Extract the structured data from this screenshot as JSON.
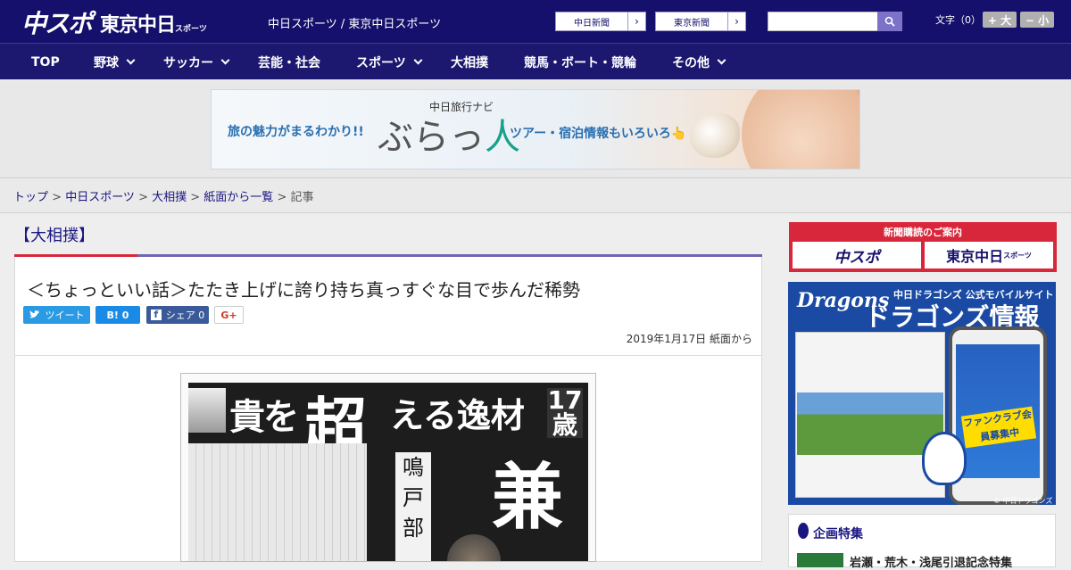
{
  "header": {
    "logo_chunichi_sports": "中スポ",
    "logo_tokyo_chunichi": "東京中日",
    "logo_tokyo_chunichi_sub": "スポーツ",
    "site_name": "中日スポーツ / 東京中日スポーツ",
    "link_chunichi_shimbun": "中日新聞",
    "link_tokyo_shimbun": "東京新聞",
    "search_placeholder": "",
    "font_size_label": "文字（0）",
    "font_larger": "+ 大",
    "font_smaller": "− 小"
  },
  "nav": {
    "items": [
      {
        "label": "TOP"
      },
      {
        "label": "野球"
      },
      {
        "label": "サッカー"
      },
      {
        "label": "芸能・社会"
      },
      {
        "label": "スポーツ"
      },
      {
        "label": "大相撲"
      },
      {
        "label": "競馬・ボート・競輪"
      },
      {
        "label": "その他"
      }
    ]
  },
  "ad_banner": {
    "lead": "旅の魅力がまるわかり!!",
    "small_title": "中日旅行ナビ",
    "brand_a": "ぶらっ",
    "brand_b": "人",
    "sub": "ツアー・宿泊情報もいろいろ👆"
  },
  "breadcrumb": {
    "top": "トップ",
    "sports": "中日スポーツ",
    "sumo": "大相撲",
    "list": "紙面から一覧",
    "current": "記事",
    "sep": " > "
  },
  "article": {
    "section": "【大相撲】",
    "headline": "＜ちょっといい話＞たたき上げに誇り持ち真っすぐな目で歩んだ稀勢",
    "share_twitter": "ツイート",
    "share_hatena": "B! 0",
    "share_facebook": "シェア 0",
    "share_gplus": "G+",
    "date": "2019年1月17日 紙面から",
    "clip_head1": "貴を",
    "clip_head2": "超",
    "clip_head3": "える逸材",
    "clip_age": "17歳",
    "clip_col": "鳴戸部",
    "clip_big": "兼"
  },
  "sidebar": {
    "subscribe_caption": "新聞購読のご案内",
    "subscribe_logo1": "中スポ",
    "subscribe_logo2": "東京中日",
    "subscribe_logo2_sub": "スポーツ",
    "dragons_logo": "Dragons",
    "dragons_sub": "中日ドラゴンズ 公式モバイルサイト",
    "dragons_title": "ドラゴンズ情報",
    "dragons_fanclub": "ファンクラブ会員募集中",
    "dragons_copy": "© 中日ドラゴンズ",
    "feature_title": "企画特集",
    "feature_item": "岩瀬・荒木・浅尾引退記念特集"
  },
  "colors": {
    "header_bg": "#14106b",
    "nav_bg": "#1c1870",
    "accent_red": "#d8273b",
    "accent_purple": "#6e65b5",
    "link": "#1a1680"
  }
}
